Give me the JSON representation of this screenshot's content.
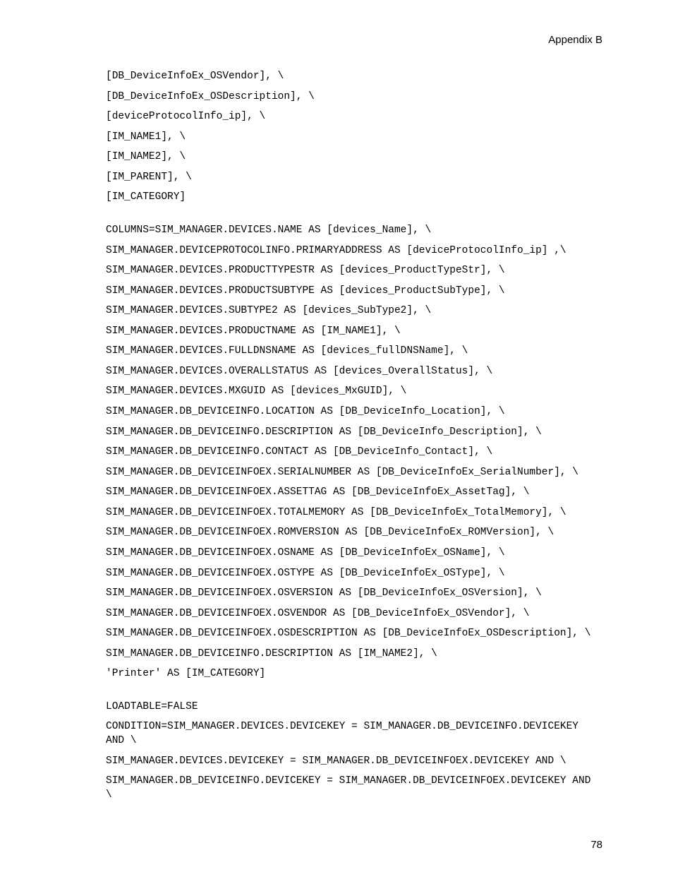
{
  "header": "Appendix B",
  "lines": [
    "[DB_DeviceInfoEx_OSVendor], \\",
    "[DB_DeviceInfoEx_OSDescription], \\",
    "[deviceProtocolInfo_ip], \\",
    "[IM_NAME1], \\",
    "[IM_NAME2], \\",
    "[IM_PARENT], \\",
    "[IM_CATEGORY]",
    "",
    "COLUMNS=SIM_MANAGER.DEVICES.NAME AS [devices_Name], \\",
    "SIM_MANAGER.DEVICEPROTOCOLINFO.PRIMARYADDRESS AS [deviceProtocolInfo_ip] ,\\",
    "SIM_MANAGER.DEVICES.PRODUCTTYPESTR AS [devices_ProductTypeStr], \\",
    "SIM_MANAGER.DEVICES.PRODUCTSUBTYPE AS [devices_ProductSubType], \\",
    "SIM_MANAGER.DEVICES.SUBTYPE2 AS [devices_SubType2], \\",
    "SIM_MANAGER.DEVICES.PRODUCTNAME AS [IM_NAME1], \\",
    "SIM_MANAGER.DEVICES.FULLDNSNAME AS [devices_fullDNSName], \\",
    "SIM_MANAGER.DEVICES.OVERALLSTATUS AS [devices_OverallStatus], \\",
    "SIM_MANAGER.DEVICES.MXGUID AS [devices_MxGUID], \\",
    "SIM_MANAGER.DB_DEVICEINFO.LOCATION AS [DB_DeviceInfo_Location], \\",
    "SIM_MANAGER.DB_DEVICEINFO.DESCRIPTION AS [DB_DeviceInfo_Description], \\",
    "SIM_MANAGER.DB_DEVICEINFO.CONTACT AS [DB_DeviceInfo_Contact], \\",
    "SIM_MANAGER.DB_DEVICEINFOEX.SERIALNUMBER AS [DB_DeviceInfoEx_SerialNumber], \\",
    "SIM_MANAGER.DB_DEVICEINFOEX.ASSETTAG AS [DB_DeviceInfoEx_AssetTag], \\",
    "SIM_MANAGER.DB_DEVICEINFOEX.TOTALMEMORY AS [DB_DeviceInfoEx_TotalMemory], \\",
    "SIM_MANAGER.DB_DEVICEINFOEX.ROMVERSION AS [DB_DeviceInfoEx_ROMVersion], \\",
    "SIM_MANAGER.DB_DEVICEINFOEX.OSNAME AS [DB_DeviceInfoEx_OSName], \\",
    "SIM_MANAGER.DB_DEVICEINFOEX.OSTYPE AS [DB_DeviceInfoEx_OSType], \\",
    "SIM_MANAGER.DB_DEVICEINFOEX.OSVERSION AS [DB_DeviceInfoEx_OSVersion], \\",
    "SIM_MANAGER.DB_DEVICEINFOEX.OSVENDOR AS [DB_DeviceInfoEx_OSVendor], \\",
    "SIM_MANAGER.DB_DEVICEINFOEX.OSDESCRIPTION AS [DB_DeviceInfoEx_OSDescription], \\",
    "SIM_MANAGER.DB_DEVICEINFO.DESCRIPTION AS [IM_NAME2], \\",
    "'Printer' AS [IM_CATEGORY]",
    "",
    "LOADTABLE=FALSE",
    "CONDITION=SIM_MANAGER.DEVICES.DEVICEKEY = SIM_MANAGER.DB_DEVICEINFO.DEVICEKEY AND \\",
    "SIM_MANAGER.DEVICES.DEVICEKEY = SIM_MANAGER.DB_DEVICEINFOEX.DEVICEKEY AND \\",
    "SIM_MANAGER.DB_DEVICEINFO.DEVICEKEY = SIM_MANAGER.DB_DEVICEINFOEX.DEVICEKEY AND \\"
  ],
  "pageNumber": "78"
}
